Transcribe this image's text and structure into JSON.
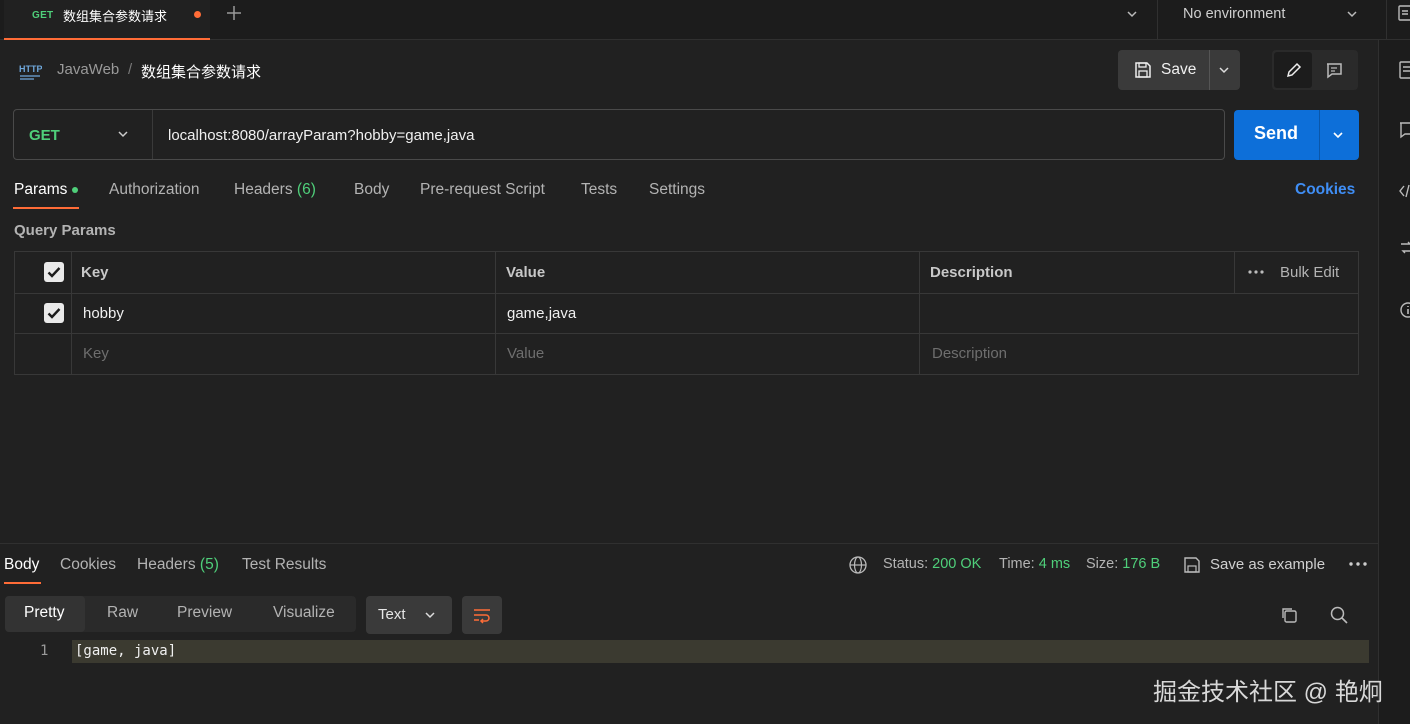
{
  "tab": {
    "method": "GET",
    "title": "数组集合参数请求"
  },
  "environment": {
    "selected": "No environment"
  },
  "breadcrumb": {
    "collection": "JavaWeb",
    "separator": "/",
    "request": "数组集合参数请求"
  },
  "toolbar": {
    "save_label": "Save"
  },
  "request": {
    "method": "GET",
    "url": "localhost:8080/arrayParam?hobby=game,java",
    "send_label": "Send"
  },
  "request_tabs": {
    "params": "Params",
    "authorization": "Authorization",
    "headers": "Headers",
    "headers_count": "(6)",
    "body": "Body",
    "prerequest": "Pre-request Script",
    "tests": "Tests",
    "settings": "Settings",
    "cookies": "Cookies"
  },
  "query_params": {
    "label": "Query Params",
    "columns": {
      "key": "Key",
      "value": "Value",
      "description": "Description"
    },
    "bulk_edit": "Bulk Edit",
    "rows": [
      {
        "key": "hobby",
        "value": "game,java",
        "description": ""
      }
    ],
    "placeholders": {
      "key": "Key",
      "value": "Value",
      "description": "Description"
    }
  },
  "response": {
    "tabs": {
      "body": "Body",
      "cookies": "Cookies",
      "headers": "Headers",
      "headers_count": "(5)",
      "test_results": "Test Results"
    },
    "status_label": "Status:",
    "status": "200 OK",
    "time_label": "Time:",
    "time": "4 ms",
    "size_label": "Size:",
    "size": "176 B",
    "save_example": "Save as example",
    "formats": {
      "pretty": "Pretty",
      "raw": "Raw",
      "preview": "Preview",
      "visualize": "Visualize"
    },
    "type": "Text",
    "lines": [
      {
        "num": "1",
        "text": "[game, java]"
      }
    ]
  },
  "watermark": "掘金技术社区 @ 艳炯",
  "colors": {
    "accent": "#ff6c37",
    "send": "#0d6fd9",
    "get_method": "#4fcf7a",
    "link": "#3f8ef5"
  }
}
